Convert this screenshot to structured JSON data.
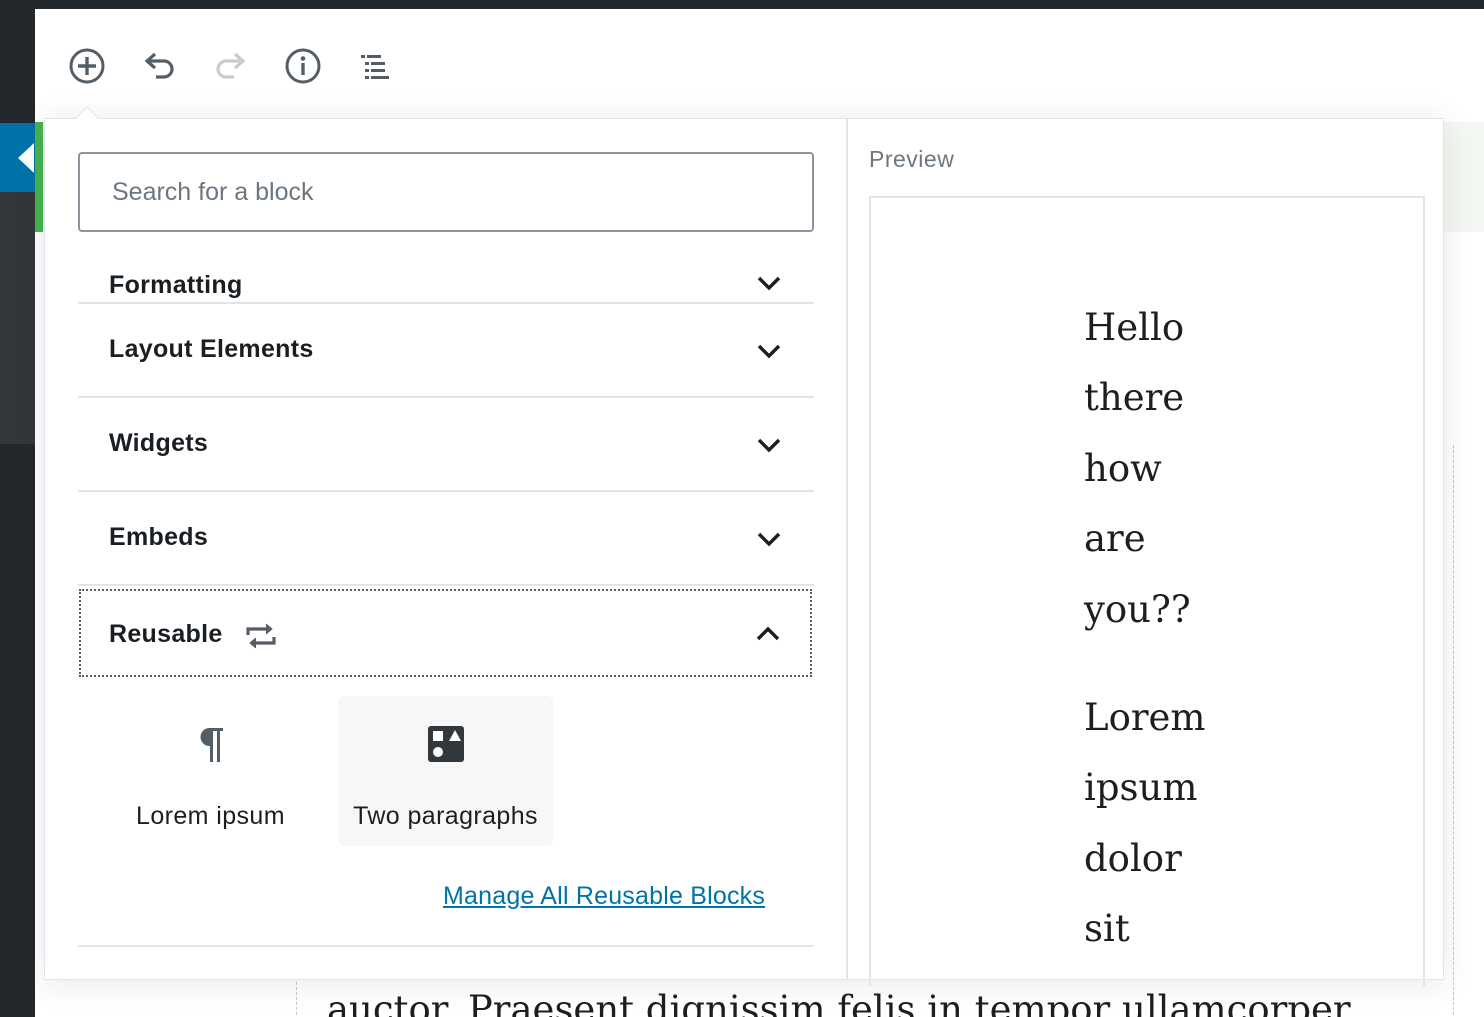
{
  "toolbar": {
    "buttons": [
      {
        "name": "add-block",
        "icon": "plus-circle-icon"
      },
      {
        "name": "undo",
        "icon": "undo-icon"
      },
      {
        "name": "redo",
        "icon": "redo-icon"
      },
      {
        "name": "info",
        "icon": "info-icon"
      },
      {
        "name": "outline",
        "icon": "list-icon"
      }
    ]
  },
  "inserter": {
    "search_placeholder": "Search for a block",
    "panels": {
      "formatting": "Formatting",
      "layout": "Layout Elements",
      "widgets": "Widgets",
      "embeds": "Embeds",
      "reusable": "Reusable"
    },
    "reusable_blocks": [
      {
        "label": "Lorem ipsum",
        "icon": "paragraph-icon"
      },
      {
        "label": "Two paragraphs",
        "icon": "shapes-icon"
      }
    ],
    "manage_link": "Manage All Reusable Blocks"
  },
  "preview": {
    "title": "Preview",
    "paragraph1": [
      "Hello",
      "there",
      "how",
      "are",
      "you??"
    ],
    "paragraph2": [
      "Lorem",
      "ipsum",
      "dolor",
      "sit"
    ]
  },
  "background": {
    "content_text": "auctor. Praesent dignissim felis in tempor ullamcorper."
  },
  "colors": {
    "accent": "#0073aa",
    "admin_bar": "#23282d",
    "notice_green": "#46b450"
  }
}
